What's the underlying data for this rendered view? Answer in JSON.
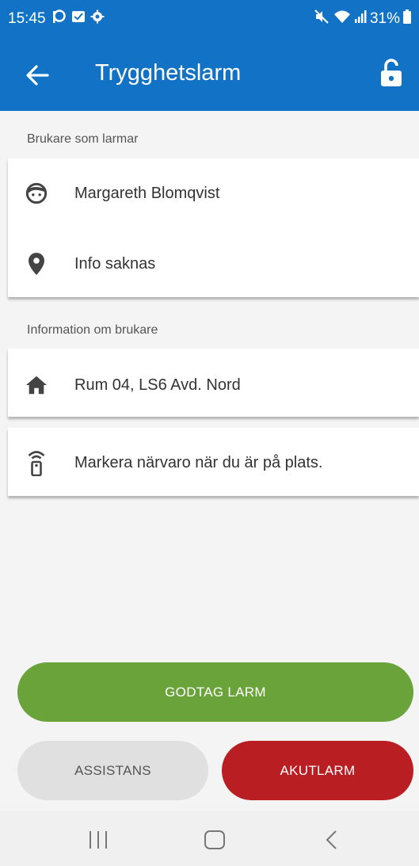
{
  "status_bar": {
    "time": "15:45",
    "battery": "31%",
    "left_icons": [
      "p-icon",
      "message-icon",
      "settings-icon"
    ],
    "right_icons": [
      "mute-icon",
      "wifi-icon",
      "signal-icon",
      "battery-icon"
    ]
  },
  "app_bar": {
    "title": "Trygghetslarm",
    "back_icon": "arrow-left-icon",
    "action_icon": "lock-open-icon",
    "color": "#1272c5"
  },
  "sections": {
    "alarm_user_label": "Brukare som larmar",
    "user_info_label": "Information om brukare"
  },
  "alarm_user": {
    "name": "Margareth Blomqvist",
    "location": "Info saknas"
  },
  "user_info": {
    "room": "Rum 04, LS6 Avd. Nord"
  },
  "presence": {
    "text": "Markera närvaro när du är på plats."
  },
  "buttons": {
    "accept": "GODTAG LARM",
    "assist": "ASSISTANS",
    "emergency": "AKUTLARM",
    "accept_color": "#6ba33b",
    "assist_color": "#e0e0e0",
    "emergency_color": "#b91e22"
  },
  "nav": {
    "icons": [
      "recent-apps-icon",
      "home-icon",
      "back-icon"
    ]
  }
}
